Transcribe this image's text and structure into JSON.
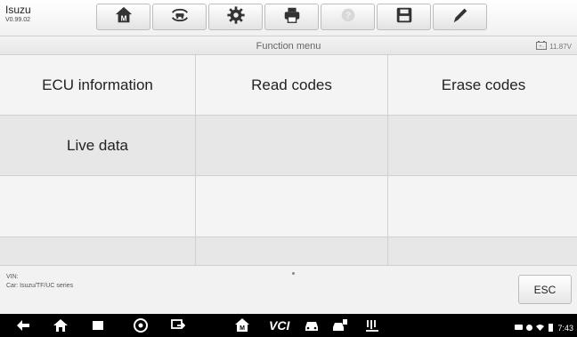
{
  "header": {
    "make": "Isuzu",
    "version": "V0.99.02"
  },
  "toolbar": {
    "buttons": [
      {
        "icon": "home-icon"
      },
      {
        "icon": "vehicle-swap-icon"
      },
      {
        "icon": "settings-gear-icon"
      },
      {
        "icon": "print-icon"
      },
      {
        "icon": "help-icon"
      },
      {
        "icon": "save-icon"
      },
      {
        "icon": "pen-icon"
      }
    ]
  },
  "menu": {
    "title": "Function menu",
    "battery": "11.87V"
  },
  "functions": {
    "rows": [
      [
        "ECU information",
        "Read codes",
        "Erase codes"
      ],
      [
        "Live data",
        "",
        ""
      ],
      [
        "",
        "",
        ""
      ],
      [
        "",
        "",
        ""
      ]
    ]
  },
  "info": {
    "vin_label": "VIN:",
    "car_label": "Car: Isuzu/TF/UC series",
    "esc": "ESC"
  },
  "navbar": {
    "vci_label": "VCI",
    "time": "7:43"
  },
  "colors": {
    "toolbar_bg": "#f1f1f1",
    "grid_row_light": "#f4f4f4",
    "grid_row_dark": "#e7e7e7",
    "navbar_bg": "#000000"
  }
}
